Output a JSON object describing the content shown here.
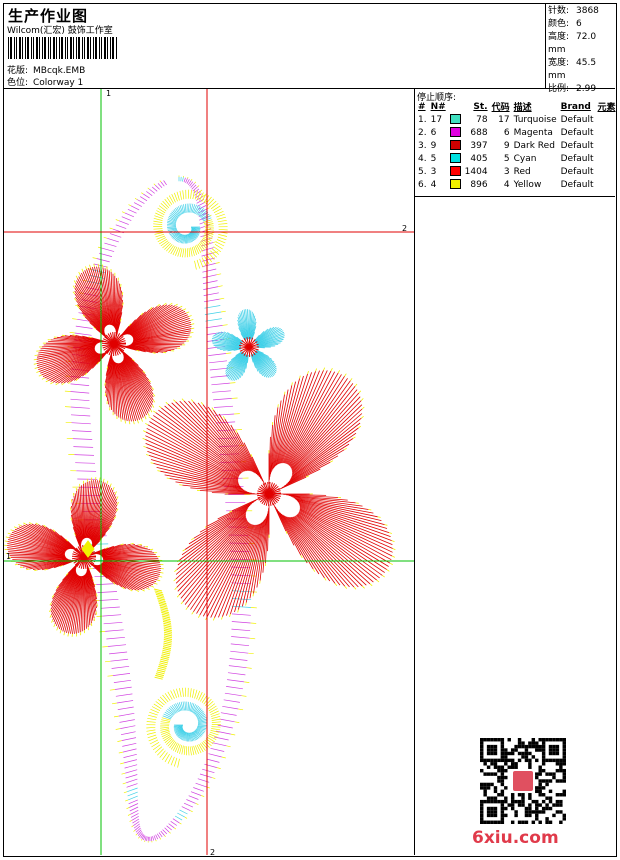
{
  "header": {
    "title": "生产作业图",
    "subtitle": "Wilcom(汇宏) 鼓饰工作室",
    "design_label": "花版:",
    "design_value": "MBcqk.EMB",
    "colorway_label": "色位:",
    "colorway_value": "Colorway 1"
  },
  "stats": [
    {
      "label": "针数:",
      "value": "3868"
    },
    {
      "label": "颜色:",
      "value": "6"
    },
    {
      "label": "高度:",
      "value": "72.0 mm"
    },
    {
      "label": "宽度:",
      "value": "45.5 mm"
    },
    {
      "label": "比例:",
      "value": "2.99"
    }
  ],
  "guides": {
    "v1": "1",
    "v2": "2",
    "h1": "1",
    "h2": "2"
  },
  "stop_sequence": {
    "title": "停止顺序:",
    "headers": [
      "#",
      "N#",
      "St.",
      "代码",
      "描述",
      "Brand",
      "元素"
    ],
    "rows": [
      {
        "idx": "1.",
        "n": "17",
        "color": "#40e0c0",
        "st": "78",
        "code": "17",
        "desc": "Turquoise",
        "brand": "Default"
      },
      {
        "idx": "2.",
        "n": "6",
        "color": "#e000e0",
        "st": "688",
        "code": "6",
        "desc": "Magenta",
        "brand": "Default"
      },
      {
        "idx": "3.",
        "n": "9",
        "color": "#d00000",
        "st": "397",
        "code": "9",
        "desc": "Dark Red",
        "brand": "Default"
      },
      {
        "idx": "4.",
        "n": "5",
        "color": "#00e0e0",
        "st": "405",
        "code": "5",
        "desc": "Cyan",
        "brand": "Default"
      },
      {
        "idx": "5.",
        "n": "3",
        "color": "#ff0000",
        "st": "1404",
        "code": "3",
        "desc": "Red",
        "brand": "Default"
      },
      {
        "idx": "6.",
        "n": "4",
        "color": "#f0f000",
        "st": "896",
        "code": "4",
        "desc": "Yellow",
        "brand": "Default"
      }
    ]
  },
  "watermark": "6xiu.com",
  "colors": {
    "guide_green": "#00c000",
    "guide_red": "#e00000",
    "red": "#e00000",
    "magenta": "#d040e0",
    "yellow": "#f0f000",
    "cyan": "#40d0e8"
  }
}
